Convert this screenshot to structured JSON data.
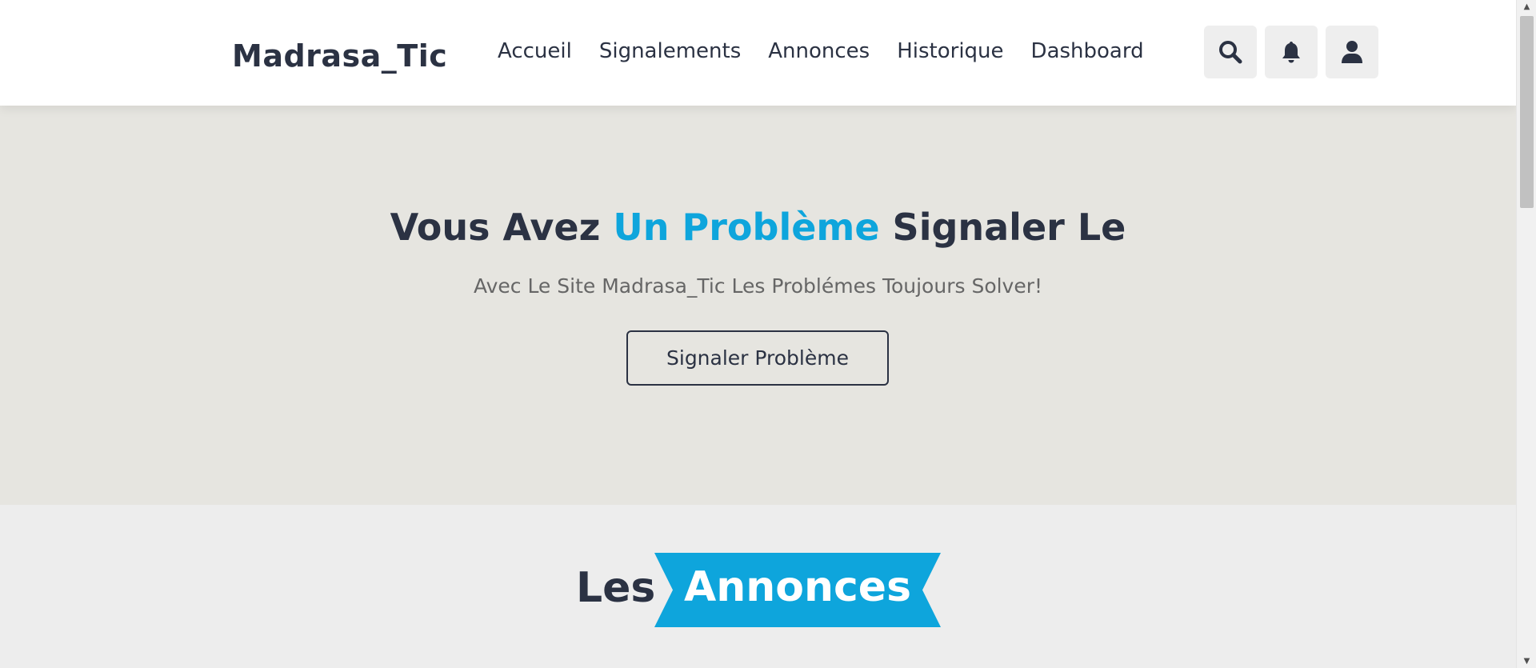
{
  "header": {
    "logo": "Madrasa_Tic",
    "nav": [
      "Accueil",
      "Signalements",
      "Annonces",
      "Historique",
      "Dashboard"
    ],
    "icons": {
      "search": "search-icon",
      "notifications": "bell-icon",
      "profile": "user-icon"
    }
  },
  "hero": {
    "title_before": "Vous Avez ",
    "title_accent": "Un Problème",
    "title_after": " Signaler Le",
    "subtitle": "Avec Le Site Madrasa_Tic Les Problémes Toujours Solver!",
    "button": "Signaler Problème"
  },
  "annonces": {
    "heading_prefix": "Les",
    "heading_ribbon": "Annonces"
  },
  "colors": {
    "accent": "#0ea5dc",
    "dark": "#2b3243",
    "hero_bg": "#e6e5e0",
    "section_bg": "#ededed"
  }
}
